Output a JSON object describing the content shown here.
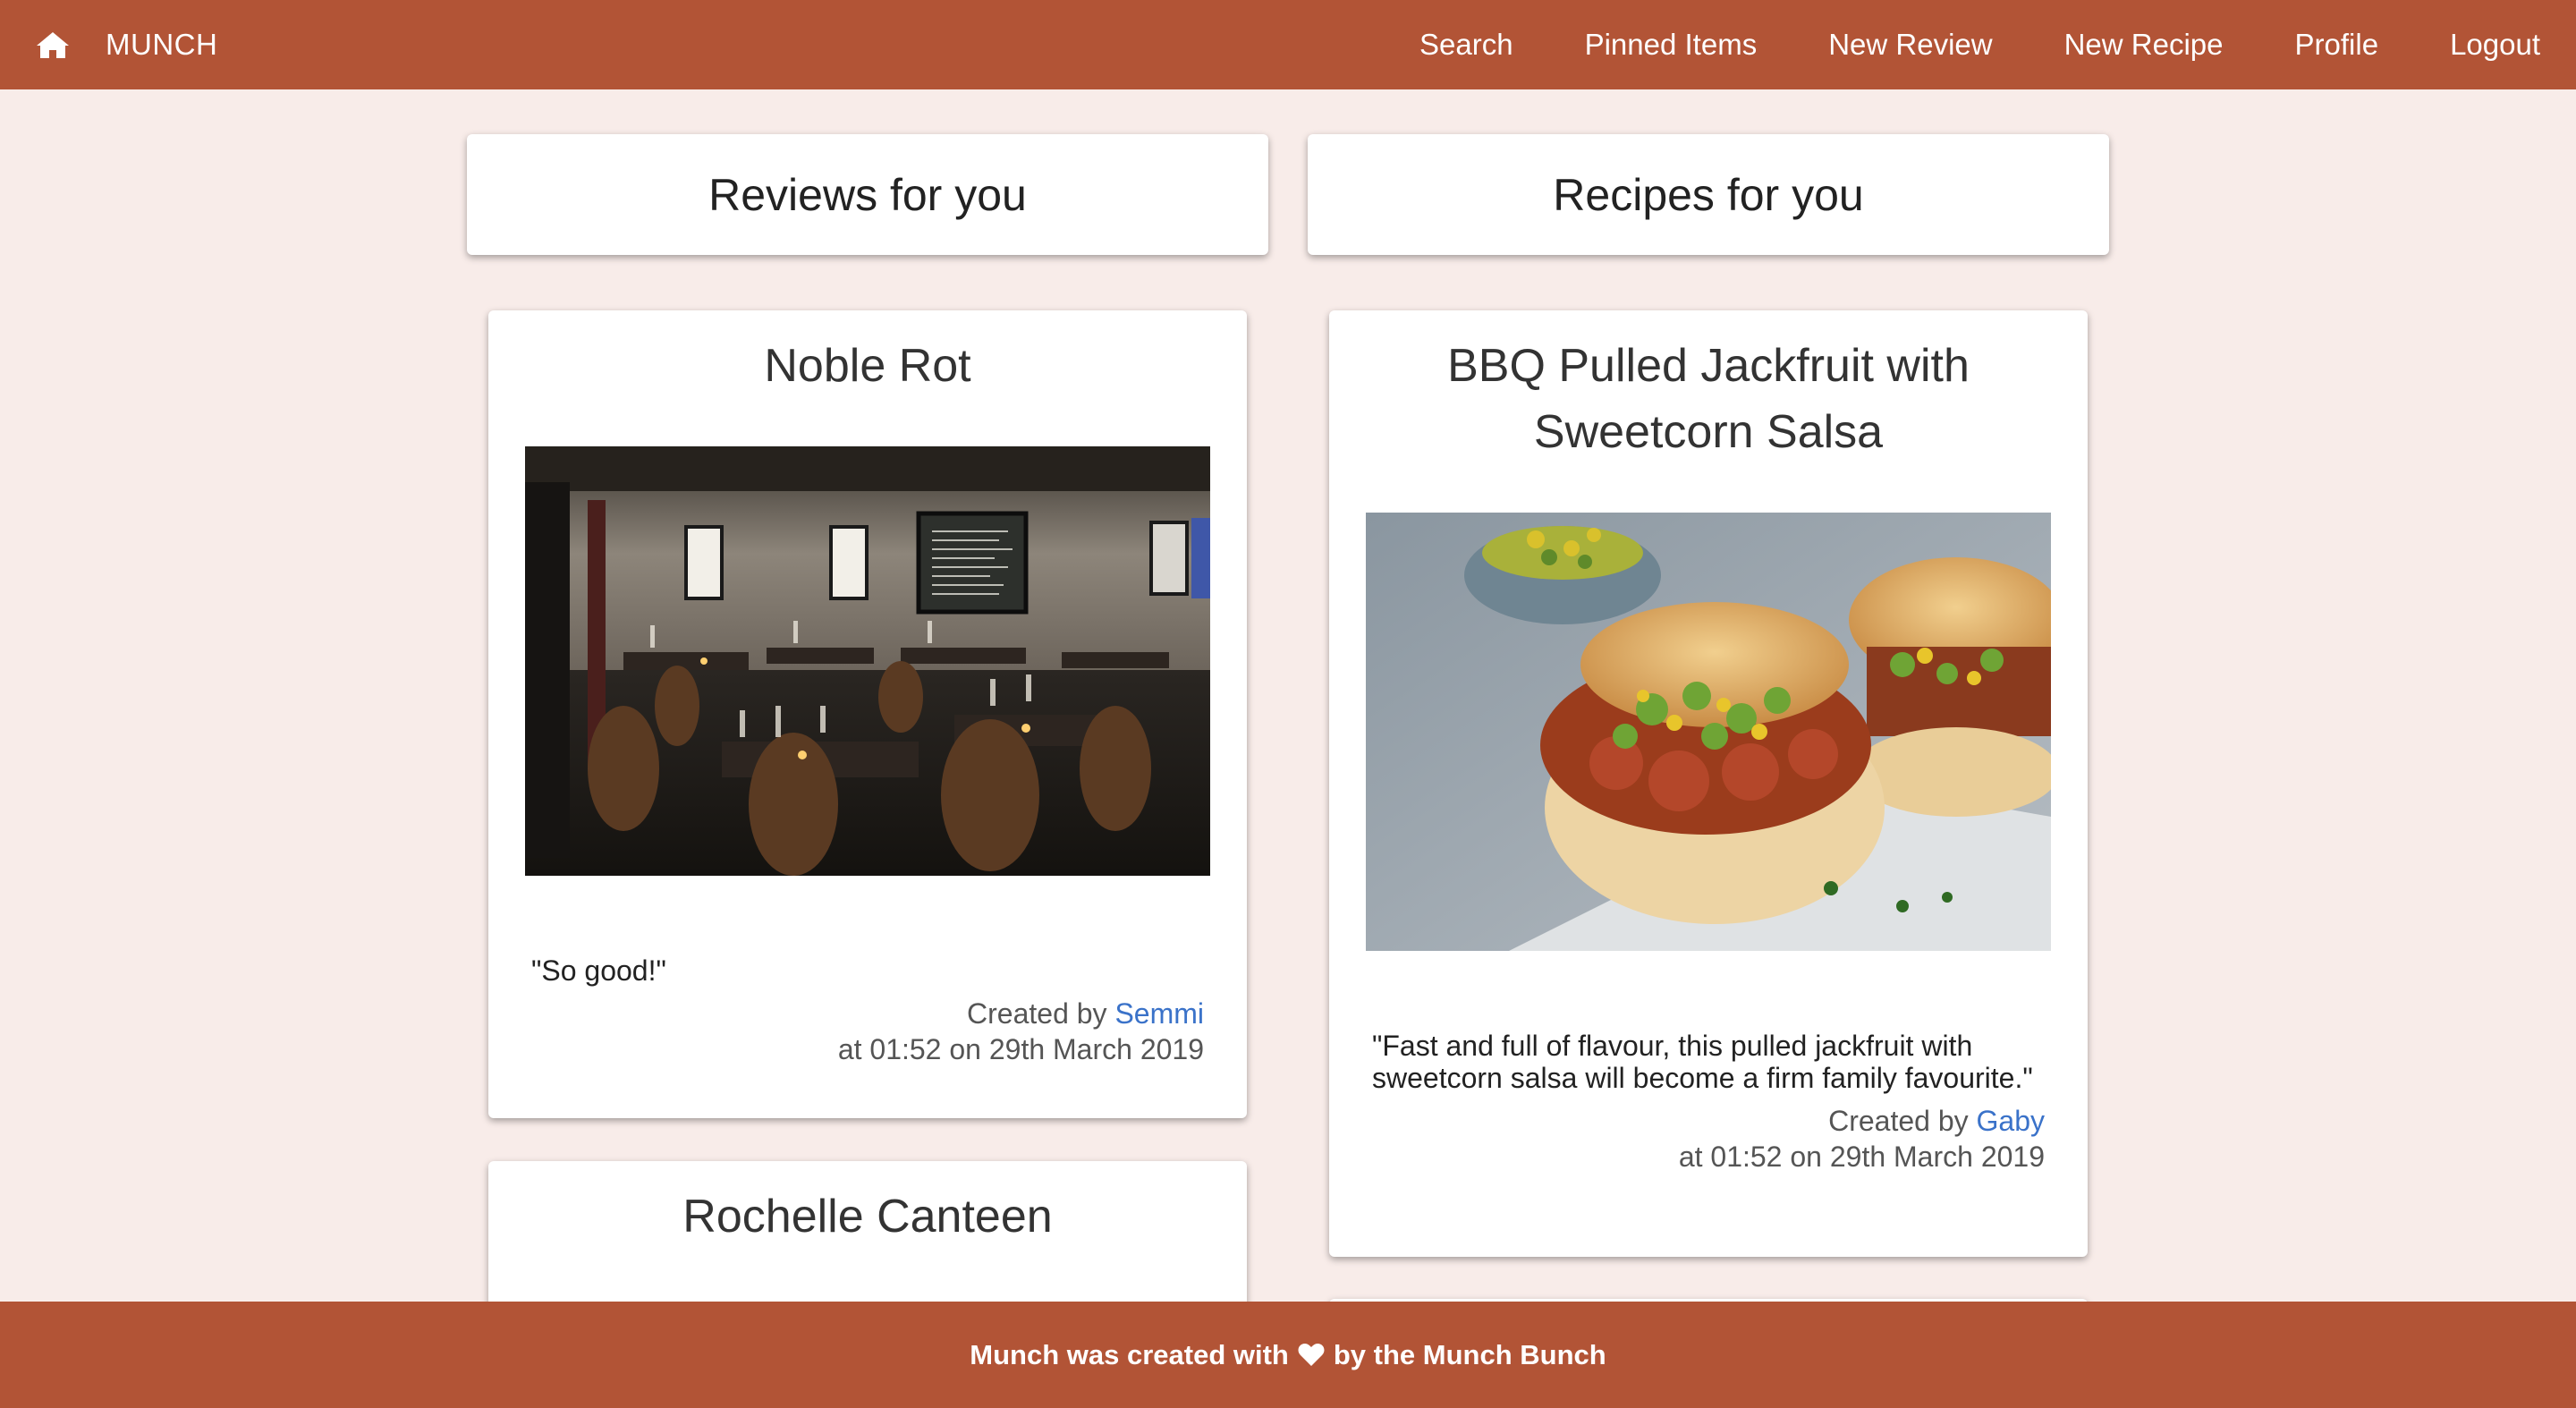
{
  "brand": {
    "name": "MUNCH",
    "icon": "home-icon"
  },
  "nav": {
    "links": [
      {
        "label": "Search"
      },
      {
        "label": "Pinned Items"
      },
      {
        "label": "New Review"
      },
      {
        "label": "New Recipe"
      },
      {
        "label": "Profile"
      },
      {
        "label": "Logout"
      }
    ]
  },
  "reviews": {
    "heading": "Reviews for you",
    "items": [
      {
        "title": "Noble Rot",
        "image": "restaurant-interior-photo",
        "quote": "\"So good!\"",
        "created_by_prefix": "Created by ",
        "author": "Semmi",
        "timestamp": "at 01:52 on 29th March 2019"
      },
      {
        "title": "Rochelle Canteen"
      }
    ]
  },
  "recipes": {
    "heading": "Recipes for you",
    "items": [
      {
        "title": "BBQ Pulled Jackfruit with Sweetcorn Salsa",
        "image": "jackfruit-burger-photo",
        "quote": "\"Fast and full of flavour, this pulled jackfruit with sweetcorn salsa will become a firm family favourite.\"",
        "created_by_prefix": "Created by ",
        "author": "Gaby",
        "timestamp": "at 01:52 on 29th March 2019"
      }
    ]
  },
  "footer": {
    "text_before": "Munch was created with",
    "heart_icon": "heart-icon",
    "text_after": "by the Munch Bunch"
  },
  "colors": {
    "brand": "#b25436",
    "background": "#f8ece9",
    "link": "#3a72c9"
  }
}
